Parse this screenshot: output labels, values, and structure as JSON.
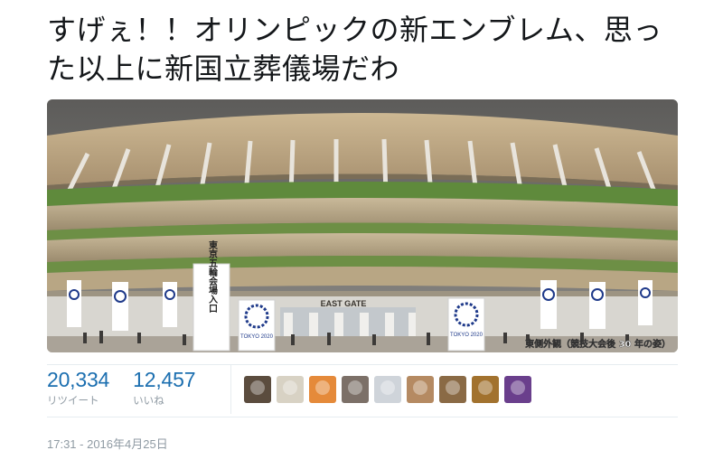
{
  "tweet": {
    "text_line1": "すげぇ！！オリンピックの新エンブレム、思っ",
    "text_line2": "た以上に新国立葬儀場だわ"
  },
  "photo": {
    "signboard_text": "東京五輪会場入口",
    "gate_text": "EAST GATE",
    "emblem_label": "TOKYO 2020",
    "caption": "東側外観（競技大会後 30 年の姿）",
    "emblem_color": "#1f3a8a"
  },
  "stats": {
    "retweets_count": "20,334",
    "retweets_label": "リツイート",
    "likes_count": "12,457",
    "likes_label": "いいね",
    "count_color": "#1c6fb0"
  },
  "avatars": [
    {
      "name": "avatar-1",
      "color": "#5b4c3e"
    },
    {
      "name": "avatar-2",
      "color": "#d8d2c4"
    },
    {
      "name": "avatar-3",
      "color": "#e58a3a"
    },
    {
      "name": "avatar-4",
      "color": "#7c7068"
    },
    {
      "name": "avatar-5",
      "color": "#cfd4da"
    },
    {
      "name": "avatar-6",
      "color": "#b58a62"
    },
    {
      "name": "avatar-7",
      "color": "#8a6a45"
    },
    {
      "name": "avatar-8",
      "color": "#a2722e"
    },
    {
      "name": "avatar-9",
      "color": "#6a3f8c"
    }
  ],
  "meta": {
    "timestamp": "17:31 - 2016年4月25日"
  }
}
